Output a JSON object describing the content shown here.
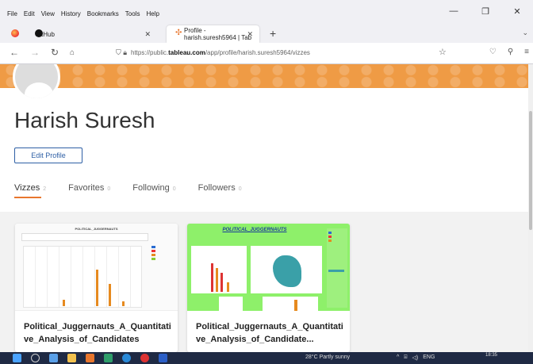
{
  "menubar": {
    "items": [
      "File",
      "Edit",
      "View",
      "History",
      "Bookmarks",
      "Tools",
      "Help"
    ]
  },
  "tabs": [
    {
      "label": "GitHub"
    },
    {
      "label": "Profile - harish.suresh5964 | Tab"
    }
  ],
  "address_bar": {
    "url_prefix": "https://public.",
    "url_domain": "tableau.com",
    "url_path": "/app/profile/harish.suresh5964/vizzes"
  },
  "profile": {
    "name": "Harish Suresh",
    "edit_label": "Edit Profile"
  },
  "profile_tabs": [
    {
      "label": "Vizzes",
      "count": "2"
    },
    {
      "label": "Favorites",
      "count": "0"
    },
    {
      "label": "Following",
      "count": "0"
    },
    {
      "label": "Followers",
      "count": "0"
    }
  ],
  "cards": [
    {
      "thumb_title": "POLITICAL_JUGGERNAUTS",
      "title": "Political_Juggernauts_A_Quantitative_Analysis_of_Candidates"
    },
    {
      "thumb_title": "POLITICAL_JUGGERNAUTS",
      "title": "Political_Juggernauts_A_Quantitative_Analysis_of_Candidate..."
    }
  ],
  "taskbar": {
    "weather": "28°C  Partly sunny",
    "lang": "ENG",
    "time": "18:35"
  },
  "colors": {
    "banner": "#ef9b45",
    "accent": "#e8762d",
    "link": "#2e5fa5",
    "viz_green": "#8ef06a"
  }
}
